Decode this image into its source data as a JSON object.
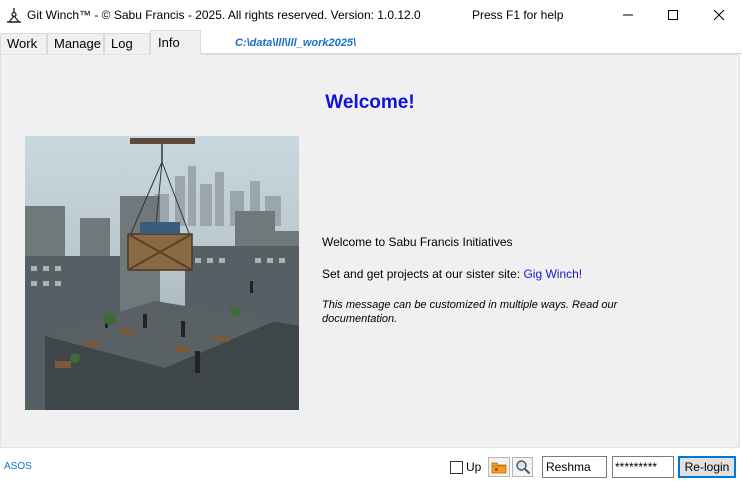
{
  "window": {
    "title": "Git Winch™  - © Sabu Francis - 2025. All rights reserved. Version: 1.0.12.0",
    "help_hint": "Press F1 for help",
    "controls": {
      "minimize_icon": "minimize-icon",
      "maximize_icon": "maximize-icon",
      "close_icon": "close-icon"
    }
  },
  "tabs": [
    {
      "label": "Work",
      "active": false
    },
    {
      "label": "Manage",
      "active": false
    },
    {
      "label": "Log",
      "active": false
    },
    {
      "label": "Info",
      "active": true
    }
  ],
  "path": "C:\\data\\lll\\lll_work2025\\",
  "info": {
    "heading": "Welcome!",
    "line1": "Welcome to Sabu Francis Initiatives",
    "line2_prefix": "Set and get projects at our sister site: ",
    "line2_link": "Gig Winch!",
    "line3": "This message can be customized in multiple ways. Read our documentation."
  },
  "statusbar": {
    "left_label": "ASOS",
    "up_checkbox_label": "Up",
    "up_checked": false,
    "username": "Reshma",
    "password_mask": "*********",
    "relogin_label": "Re-login"
  },
  "colors": {
    "heading": "#1010e0",
    "link": "#1a1ad0",
    "path": "#1a6fc8",
    "panel_bg": "#f0f0f0"
  }
}
